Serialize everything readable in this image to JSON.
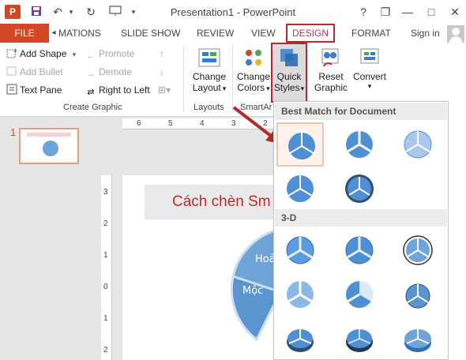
{
  "window": {
    "title": "Presentation1 - PowerPoint",
    "app_icon": "P",
    "quick_access": [
      "save-icon",
      "undo-icon",
      "redo-icon",
      "start-from-beginning-icon",
      "customize-qat-icon"
    ],
    "controls": {
      "help": "?",
      "restore": "❐",
      "minimize": "—",
      "maximize": "□",
      "close": "✕"
    }
  },
  "tabs": {
    "file": "FILE",
    "scroll": "◂",
    "items": [
      "MATIONS",
      "SLIDE SHOW",
      "REVIEW",
      "VIEW"
    ],
    "active": "DESIGN",
    "format": "FORMAT",
    "sign_in": "Sign in"
  },
  "ribbon": {
    "create_graphic": {
      "add_shape": "Add Shape",
      "add_bullet": "Add Bullet",
      "text_pane": "Text Pane",
      "promote": "Promote",
      "demote": "Demote",
      "right_to_left": "Right to Left",
      "label": "Create Graphic"
    },
    "layouts": {
      "change_layout_1": "Change",
      "change_layout_2": "Layout",
      "label": "Layouts"
    },
    "smartart_styles": {
      "change_colors_1": "Change",
      "change_colors_2": "Colors",
      "quick_styles_1": "Quick",
      "quick_styles_2": "Styles",
      "label": "SmartAr"
    },
    "reset": {
      "reset_graphic_1": "Reset",
      "reset_graphic_2": "Graphic",
      "convert": "Convert"
    }
  },
  "thumbnails": {
    "slide_number": "1"
  },
  "ruler": {
    "h_ticks": [
      "6",
      "5",
      "4",
      "3",
      "2"
    ],
    "v_ticks": [
      "3",
      "2",
      "1",
      "0",
      "1",
      "2"
    ]
  },
  "slide": {
    "title": "Cách chèn Sm",
    "diagram_labels": [
      "Hoả",
      "Mộc"
    ]
  },
  "quick_styles": {
    "section_best": "Best Match for Document",
    "section_3d": "3-D",
    "selected_index": 0,
    "best_count": 5,
    "three_d_count": 9
  },
  "colors": {
    "accent": "#d24726",
    "highlight_border": "#b22a2a",
    "design_tab_text": "#b5336a",
    "title_text": "#c0272d",
    "smartart_blue": "#4f8fd3"
  }
}
